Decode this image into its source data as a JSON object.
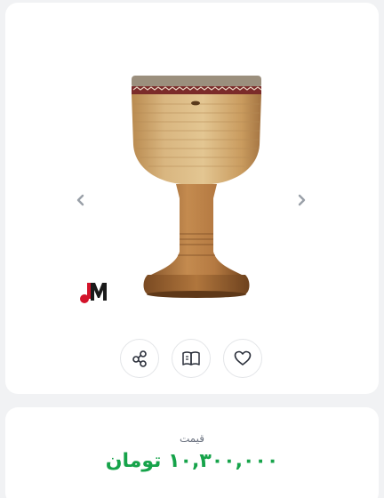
{
  "product": {
    "image_icon": "tombak-drum-image",
    "brand_logo_icon": "music-note-m-logo"
  },
  "gallery": {
    "prev_icon": "chevron-left-icon",
    "next_icon": "chevron-right-icon"
  },
  "actions": [
    {
      "icon": "share-icon"
    },
    {
      "icon": "book-open-icon"
    },
    {
      "icon": "heart-icon"
    }
  ],
  "price": {
    "label": "قیمت",
    "value": "۱۰,۳۰۰,۰۰۰ تومان"
  },
  "colors": {
    "price": "#16a34a",
    "logo_red": "#d3132a",
    "icon": "#2a2f3a",
    "arrow": "#9aa0a8"
  }
}
